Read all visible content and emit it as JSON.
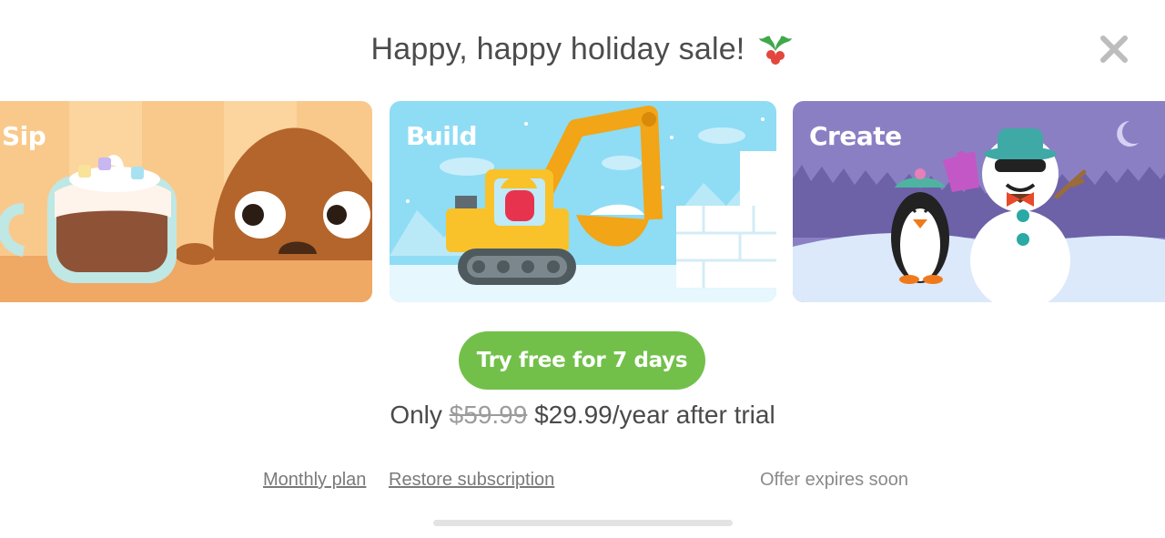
{
  "header": {
    "title": "Happy, happy holiday sale!",
    "decoration_icon": "holly-icon",
    "close_icon": "close-icon"
  },
  "cards": [
    {
      "label": "Sip",
      "theme": "hot-cocoa"
    },
    {
      "label": "Build",
      "theme": "excavator-snow-fort"
    },
    {
      "label": "Create",
      "theme": "penguin-snowman"
    }
  ],
  "cta": {
    "label": "Try free for 7 days"
  },
  "pricing": {
    "prefix": "Only",
    "original_price": "$59.99",
    "sale_price": "$29.99/year after trial"
  },
  "footer": {
    "monthly_plan": "Monthly plan",
    "restore": "Restore subscription",
    "offer": "Offer expires soon"
  },
  "colors": {
    "accent_green": "#72c04a",
    "text": "#4a4a4a",
    "close_icon": "#bdbdbd"
  }
}
